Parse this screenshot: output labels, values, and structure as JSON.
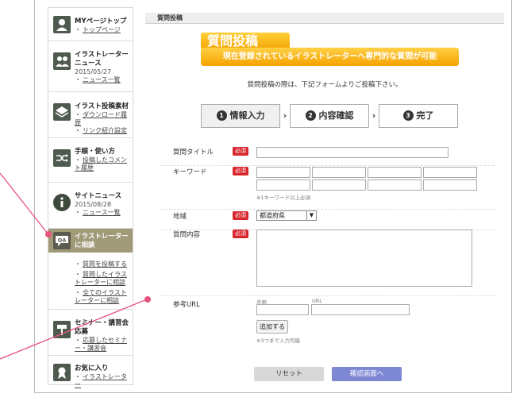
{
  "sidebar": {
    "items": [
      {
        "title": "MYページトップ",
        "links": [
          "トップページ"
        ]
      },
      {
        "title": "イラストレーターニュース",
        "date": "2015/05/27",
        "links": [
          "ニュース一覧"
        ]
      },
      {
        "title": "イラスト投稿素材",
        "links": [
          "ダウンロード履歴",
          "リンク紹介設定"
        ]
      },
      {
        "title": "手順・使い方",
        "links": [
          "投稿したコメント履歴"
        ]
      },
      {
        "title": "サイトニュース",
        "date": "2015/08/28",
        "links": [
          "ニュース一覧"
        ]
      },
      {
        "title": "イラストレーターに相談",
        "icon_text": "QA",
        "links": [
          "質問を投稿する",
          "質問したイラストレーターに相談",
          "全てのイラストレーターに相談"
        ]
      },
      {
        "title": "セミナー・講習会応募",
        "links": [
          "応募したセミナー・講習会"
        ]
      },
      {
        "title": "お気に入り",
        "links": [
          "イラストレーター"
        ]
      }
    ]
  },
  "main": {
    "header": "質問投稿",
    "banner_title": "質問投稿",
    "banner_sub": "現在登録されているイラストレーターへ専門的な質問が可能",
    "instructions": "質問投稿の際は、下記フォームよりご投稿下さい。",
    "steps": [
      {
        "num": "1",
        "label": "情報入力"
      },
      {
        "num": "2",
        "label": "内容確認"
      },
      {
        "num": "3",
        "label": "完了"
      }
    ],
    "step_sep": "›",
    "required": "必須",
    "fields": {
      "title_label": "質問タイトル",
      "keyword_label": "キーワード",
      "keyword_note": "※1キーワード以上必須",
      "region_label": "地域",
      "region_value": "都道府県",
      "content_label": "質問内容",
      "ref_label": "参考URL",
      "ref_name_label": "名称",
      "ref_url_label": "URL",
      "add_label": "追加する",
      "add_note": "※3つまで入力可能"
    },
    "reset_label": "リセット",
    "confirm_label": "確認画面へ"
  },
  "colors": {
    "accent_orange": "#f6a200",
    "required_red": "#d9262d",
    "confirm_blue": "#7e87d4",
    "active_sidebar": "#a09a78",
    "annotation_pink": "#e8527a"
  }
}
